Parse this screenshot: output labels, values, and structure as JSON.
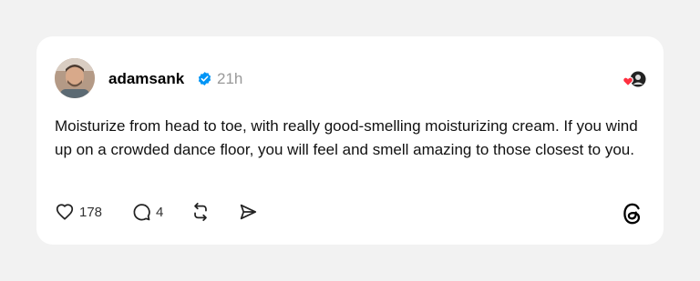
{
  "post": {
    "username": "adamsank",
    "time": "21h",
    "text": "Moisturize from head to toe, with really good-smelling moisturizing cream. If you wind up on a crowded dance floor, you will feel and smell amazing to those closest to you.",
    "likes": "178",
    "replies": "4",
    "verified": true
  },
  "icons": {
    "avatar": "profile-photo",
    "verified": "verified-badge-icon",
    "liked_by": "liked-by-avatar-icon",
    "like": "heart-icon",
    "reply": "comment-icon",
    "repost": "repost-icon",
    "share": "send-icon",
    "brand": "threads-logo"
  },
  "colors": {
    "background": "#f2f2f2",
    "card": "#ffffff",
    "verified": "#0095f6",
    "heart": "#ff3040",
    "muted": "#999999"
  }
}
